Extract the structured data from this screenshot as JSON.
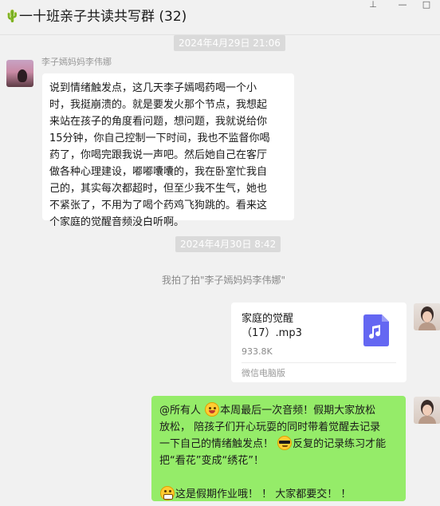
{
  "window": {
    "title": "一十班亲子共读共写群 (32)",
    "title_icon": "cactus-icon",
    "pin_glyph": "⊥",
    "minimize_glyph": "—",
    "maximize_glyph": "□"
  },
  "messages": {
    "ts1": "2024年4月29日 21:06",
    "sender1": "李子嫣妈妈李伟娜",
    "bubble1_lines": [
      "说到情绪触发点，这几天李子嫣喝药喝一个小",
      "时，我挺崩溃的。就是要发火那个节点，我想起",
      "来站在孩子的角度看问题，想问题，我就说给你",
      "15分钟，你自己控制一下时间，我也不监督你喝",
      "药了，你喝完跟我说一声吧。然后她自己在客厅",
      "做各种心理建设，嘟嘟囔囔的，我在卧室忙我自",
      "己的，其实每次都超时，但至少我不生气，她也",
      "不紧张了，不用为了喝个药鸡飞狗跳的。看来这",
      "个家庭的觉醒音频没白听啊。"
    ],
    "ts2": "2024年4月30日 8:42",
    "system": "我拍了拍\"李子嫣妈妈李伟娜\"",
    "file": {
      "name_line1": "家庭的觉醒",
      "name_line2": "（17）.mp3",
      "size": "933.8K",
      "source": "微信电脑版",
      "icon": "music-file-icon",
      "icon_color": "#6467f2"
    },
    "bubble2": {
      "l1a": "@所有人 ",
      "l1b": "本周最后一次音频！假期大家放松",
      "l2": "放松， 陪孩子们开心玩耍的同时带着觉醒去记录",
      "l3a": "一下自己的情绪触发点！ ",
      "l3b": "反复的记录练习才能",
      "l4": "把“看花”变成“绣花”！",
      "l6b": "这是假期作业哦！ ！ 大家都要交！ ！",
      "emoji1": "smile-emoji-icon",
      "emoji2": "sunglasses-emoji-icon",
      "emoji3": "grin-emoji-icon"
    }
  },
  "colors": {
    "green_bubble": "#95ec69",
    "white_bubble": "#ffffff",
    "background": "#f1f1f1"
  }
}
